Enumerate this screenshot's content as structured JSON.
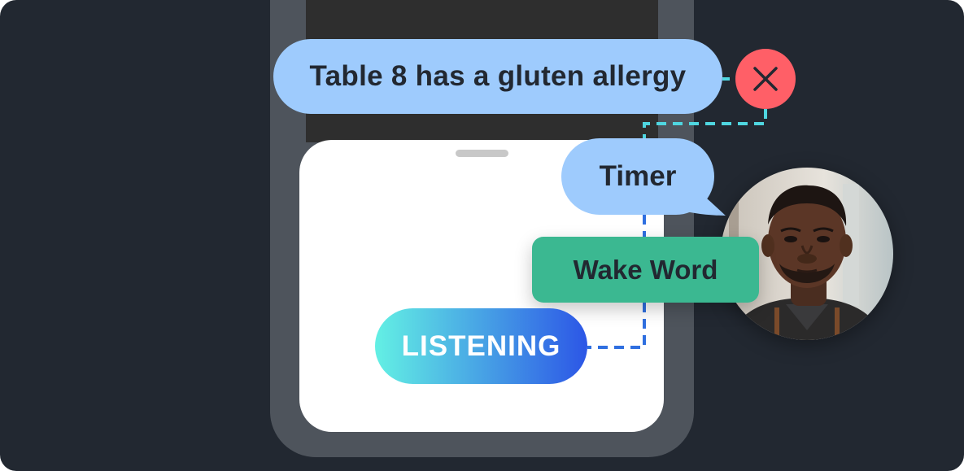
{
  "bubbles": {
    "allergy": "Table 8 has a gluten allergy",
    "timer": "Timer",
    "wake_word": "Wake Word"
  },
  "listening": {
    "label": "LISTENING"
  },
  "icons": {
    "close": "close-icon",
    "avatar": "person-photo"
  },
  "colors": {
    "background": "#222831",
    "speech_bubble": "#9ecbfd",
    "wake_word": "#3bb891",
    "listening_start": "#63f0e4",
    "listening_end": "#2c56e6",
    "close": "#ff5f67",
    "connector_cyan": "#4fd6e0",
    "connector_blue": "#2f6fe0"
  }
}
